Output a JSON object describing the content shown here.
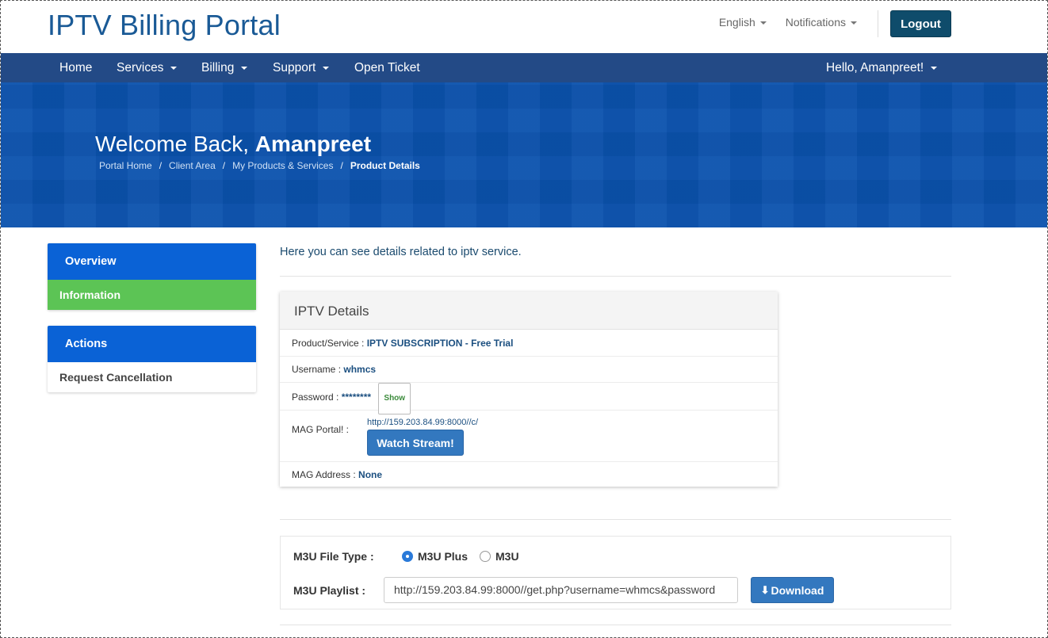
{
  "header": {
    "brand": "IPTV Billing Portal",
    "language": "English",
    "notifications": "Notifications",
    "logout": "Logout"
  },
  "nav": {
    "home": "Home",
    "services": "Services",
    "billing": "Billing",
    "support": "Support",
    "open_ticket": "Open Ticket",
    "user": "Hello, Amanpreet!"
  },
  "hero": {
    "welcome_prefix": "Welcome Back,",
    "welcome_name": "Amanpreet",
    "breadcrumb": [
      "Portal Home",
      "Client Area",
      "My Products & Services",
      "Product Details"
    ]
  },
  "sidebar": {
    "overview_title": "Overview",
    "overview_item": "Information",
    "actions_title": "Actions",
    "actions_item": "Request Cancellation"
  },
  "main": {
    "intro": "Here you can see details related to iptv service.",
    "card_title": "IPTV Details",
    "product_label": "Product/Service :",
    "product_value": "IPTV SUBSCRIPTION - Free Trial",
    "username_label": "Username :",
    "username_value": "whmcs",
    "password_label": "Password :",
    "password_value": "********",
    "show_label": "Show",
    "mag_portal_label": "MAG Portal! :",
    "mag_portal_url": "http://159.203.84.99:8000//c/",
    "watch_label": "Watch Stream!",
    "mag_address_label": "MAG Address :",
    "mag_address_value": "None"
  },
  "m3u": {
    "file_type_label": "M3U File Type :",
    "option_plus": "M3U Plus",
    "option_m3u": "M3U",
    "selected": "M3U Plus",
    "playlist_label": "M3U Playlist :",
    "playlist_url": "http://159.203.84.99:8000//get.php?username=whmcs&password",
    "download_label": "Download"
  },
  "colors": {
    "brand": "#1a5a96",
    "nav_bg": "#234a86",
    "hero_bg": "#0a52ad",
    "panel_head": "#0a62d6",
    "active_item": "#5cc455",
    "button_blue": "#3378bf",
    "logout_bg": "#0f4c6b"
  }
}
